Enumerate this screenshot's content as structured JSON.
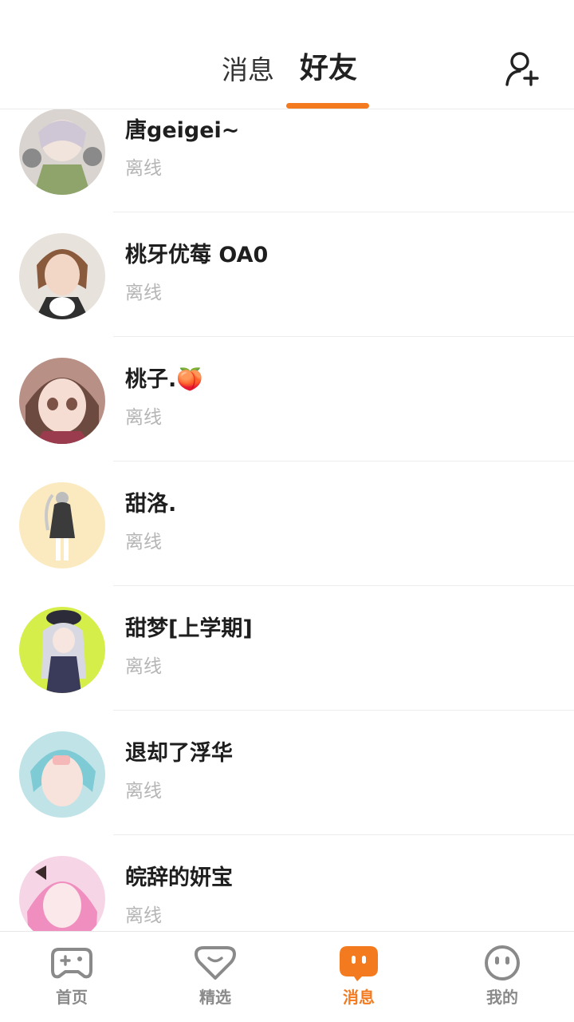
{
  "header": {
    "tabs": [
      {
        "label": "消息",
        "active": false
      },
      {
        "label": "好友",
        "active": true
      }
    ],
    "add_friend_icon": "add-user-icon",
    "accent_color": "#f47a1f"
  },
  "friends": [
    {
      "name": "唐geigei~",
      "status": "离线"
    },
    {
      "name": "桃牙优莓 OA0",
      "status": "离线"
    },
    {
      "name": "桃子.🍑",
      "status": "离线"
    },
    {
      "name": "甜洛.",
      "status": "离线"
    },
    {
      "name": "甜梦[上学期]",
      "status": "离线"
    },
    {
      "name": "退却了浮华",
      "status": "离线"
    },
    {
      "name": "皖辞的妍宝",
      "status": "离线"
    }
  ],
  "bottom_nav": [
    {
      "label": "首页",
      "icon": "gamepad-icon",
      "active": false
    },
    {
      "label": "精选",
      "icon": "heart-chat-icon",
      "active": false
    },
    {
      "label": "消息",
      "icon": "chat-bubble-icon",
      "active": true
    },
    {
      "label": "我的",
      "icon": "face-icon",
      "active": false
    }
  ]
}
